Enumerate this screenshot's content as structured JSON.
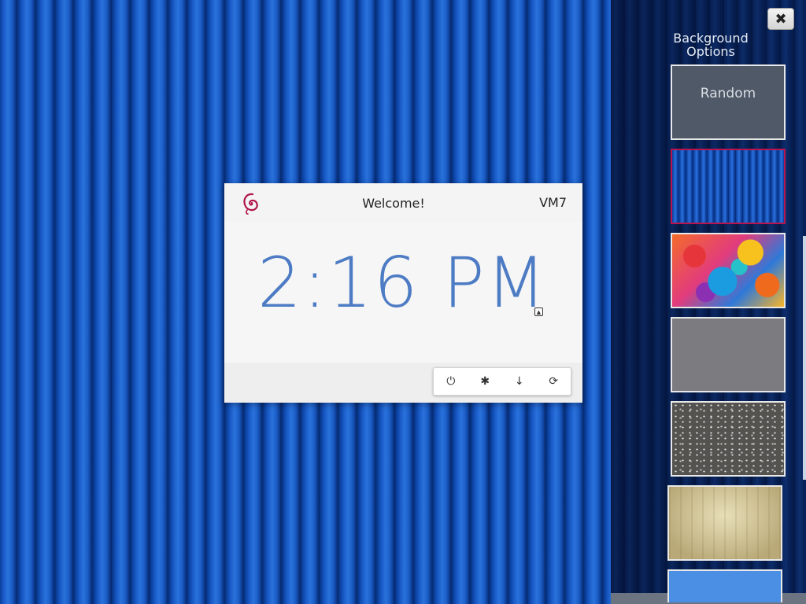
{
  "desktop": {
    "wallpaper": "blue-vertical-stripes"
  },
  "login": {
    "welcome": "Welcome!",
    "hostname": "VM7",
    "clock": "2:16 PM",
    "logo_icon": "debian-swirl-icon",
    "caret_glyph": "▲",
    "actions": [
      {
        "icon": "power-icon",
        "glyph": "⏻"
      },
      {
        "icon": "asterisk-icon",
        "glyph": "✱"
      },
      {
        "icon": "arrow-down-icon",
        "glyph": "↓"
      },
      {
        "icon": "refresh-icon",
        "glyph": "⟳"
      }
    ]
  },
  "background_panel": {
    "title": "Background Options",
    "close_glyph": "✖",
    "random_label": "Random",
    "selected_color": "#b8154e",
    "thumbnails": [
      "random",
      "blue-stripes",
      "abstract-painting",
      "gray",
      "speckled-granite",
      "wood",
      "light-blue"
    ]
  }
}
